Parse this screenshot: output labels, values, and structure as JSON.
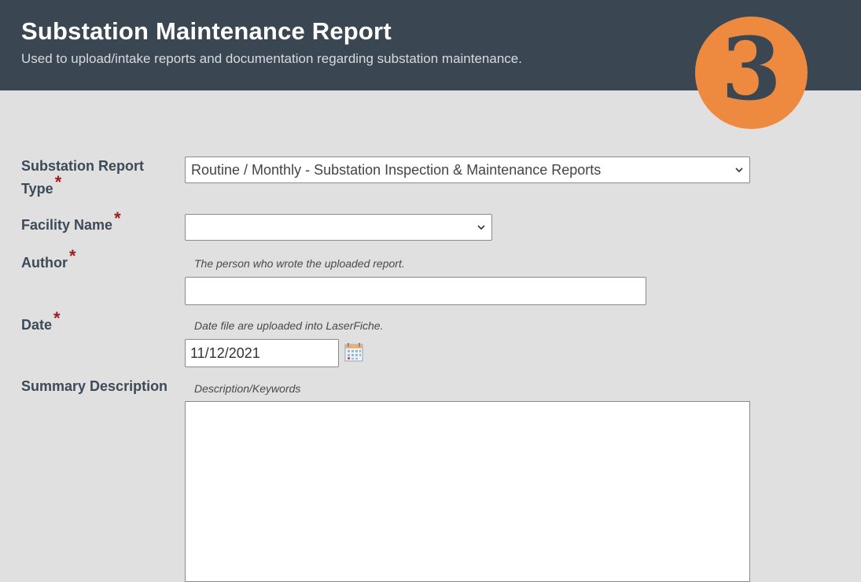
{
  "header": {
    "title": "Substation Maintenance Report",
    "subtitle": "Used to upload/intake reports and documentation regarding substation maintenance.",
    "step_number": "3",
    "bg_color": "#3a4753",
    "badge_color": "#ee8a3f"
  },
  "form": {
    "report_type": {
      "label_line1": "Substation Report",
      "label_line2": "Type",
      "required_mark": "*",
      "selected": "Routine / Monthly - Substation Inspection & Maintenance Reports"
    },
    "facility_name": {
      "label": "Facility Name",
      "required_mark": "*",
      "selected": ""
    },
    "author": {
      "label": "Author",
      "required_mark": "*",
      "hint": "The person who wrote the uploaded report.",
      "value": ""
    },
    "date": {
      "label": "Date",
      "required_mark": "*",
      "hint": "Date file are uploaded into LaserFiche.",
      "value": "11/12/2021",
      "icon": "calendar-icon"
    },
    "summary": {
      "label": "Summary Description",
      "hint": "Description/Keywords",
      "value": ""
    }
  }
}
